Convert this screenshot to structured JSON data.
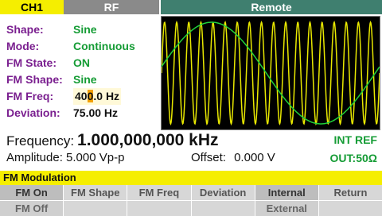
{
  "tabs": {
    "ch1": "CH1",
    "rf": "RF",
    "remote": "Remote"
  },
  "params": [
    {
      "label": "Shape:",
      "value": "Sine"
    },
    {
      "label": "Mode:",
      "value": "Continuous"
    },
    {
      "label": "FM State:",
      "value": "ON"
    },
    {
      "label": "FM Shape:",
      "value": "Sine"
    },
    {
      "label": "FM Freq:",
      "value_before": "40",
      "value_cursor": "0",
      "value_after": ".0 Hz"
    },
    {
      "label": "Deviation:",
      "value": "75.00 Hz"
    }
  ],
  "frequency": {
    "label": "Frequency:",
    "value": "1.000,000,000 kHz"
  },
  "amplitude": {
    "label": "Amplitude:",
    "value": "5.000 Vp-p"
  },
  "offset": {
    "label": "Offset:",
    "value": "0.000 V"
  },
  "status": {
    "ref": "INT REF",
    "out": "OUT:50Ω"
  },
  "menu_title": "FM Modulation",
  "softkeys": [
    {
      "top": "FM On",
      "bottom": "FM Off"
    },
    {
      "top": "FM Shape",
      "bottom": ""
    },
    {
      "top": "FM Freq",
      "bottom": ""
    },
    {
      "top": "Deviation",
      "bottom": ""
    },
    {
      "top": "Internal",
      "bottom": "External"
    },
    {
      "top": "Return",
      "bottom": ""
    }
  ],
  "colors": {
    "carrier": "#e8e800",
    "modulation": "#1fd13a",
    "accent": "#f5ee00"
  }
}
